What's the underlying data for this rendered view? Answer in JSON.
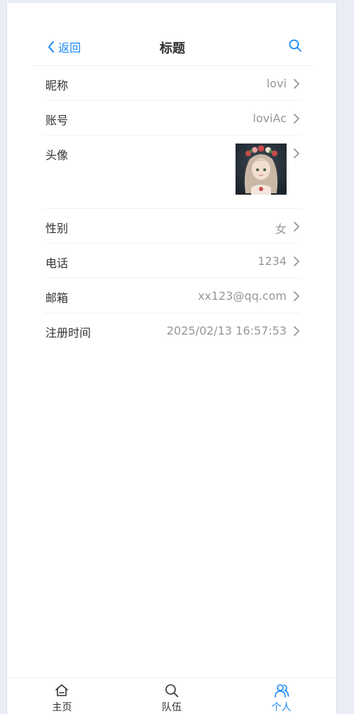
{
  "navbar": {
    "back_label": "返回",
    "title": "标题",
    "search_icon": "search-icon",
    "accent_color": "#1989fa"
  },
  "cells": [
    {
      "title": "昵称",
      "value": "lovi"
    },
    {
      "title": "账号",
      "value": "loviAc"
    },
    {
      "title": "头像",
      "value": ""
    },
    {
      "title": "性别",
      "value": "女"
    },
    {
      "title": "电话",
      "value": "1234"
    },
    {
      "title": "邮箱",
      "value": "xx123@qq.com"
    },
    {
      "title": "注册时间",
      "value": "2025/02/13 16:57:53"
    }
  ],
  "tabbar": {
    "items": [
      {
        "label": "主页",
        "icon": "home-icon",
        "active": false
      },
      {
        "label": "队伍",
        "icon": "search-icon",
        "active": false
      },
      {
        "label": "个人",
        "icon": "user-icon",
        "active": true
      }
    ]
  }
}
